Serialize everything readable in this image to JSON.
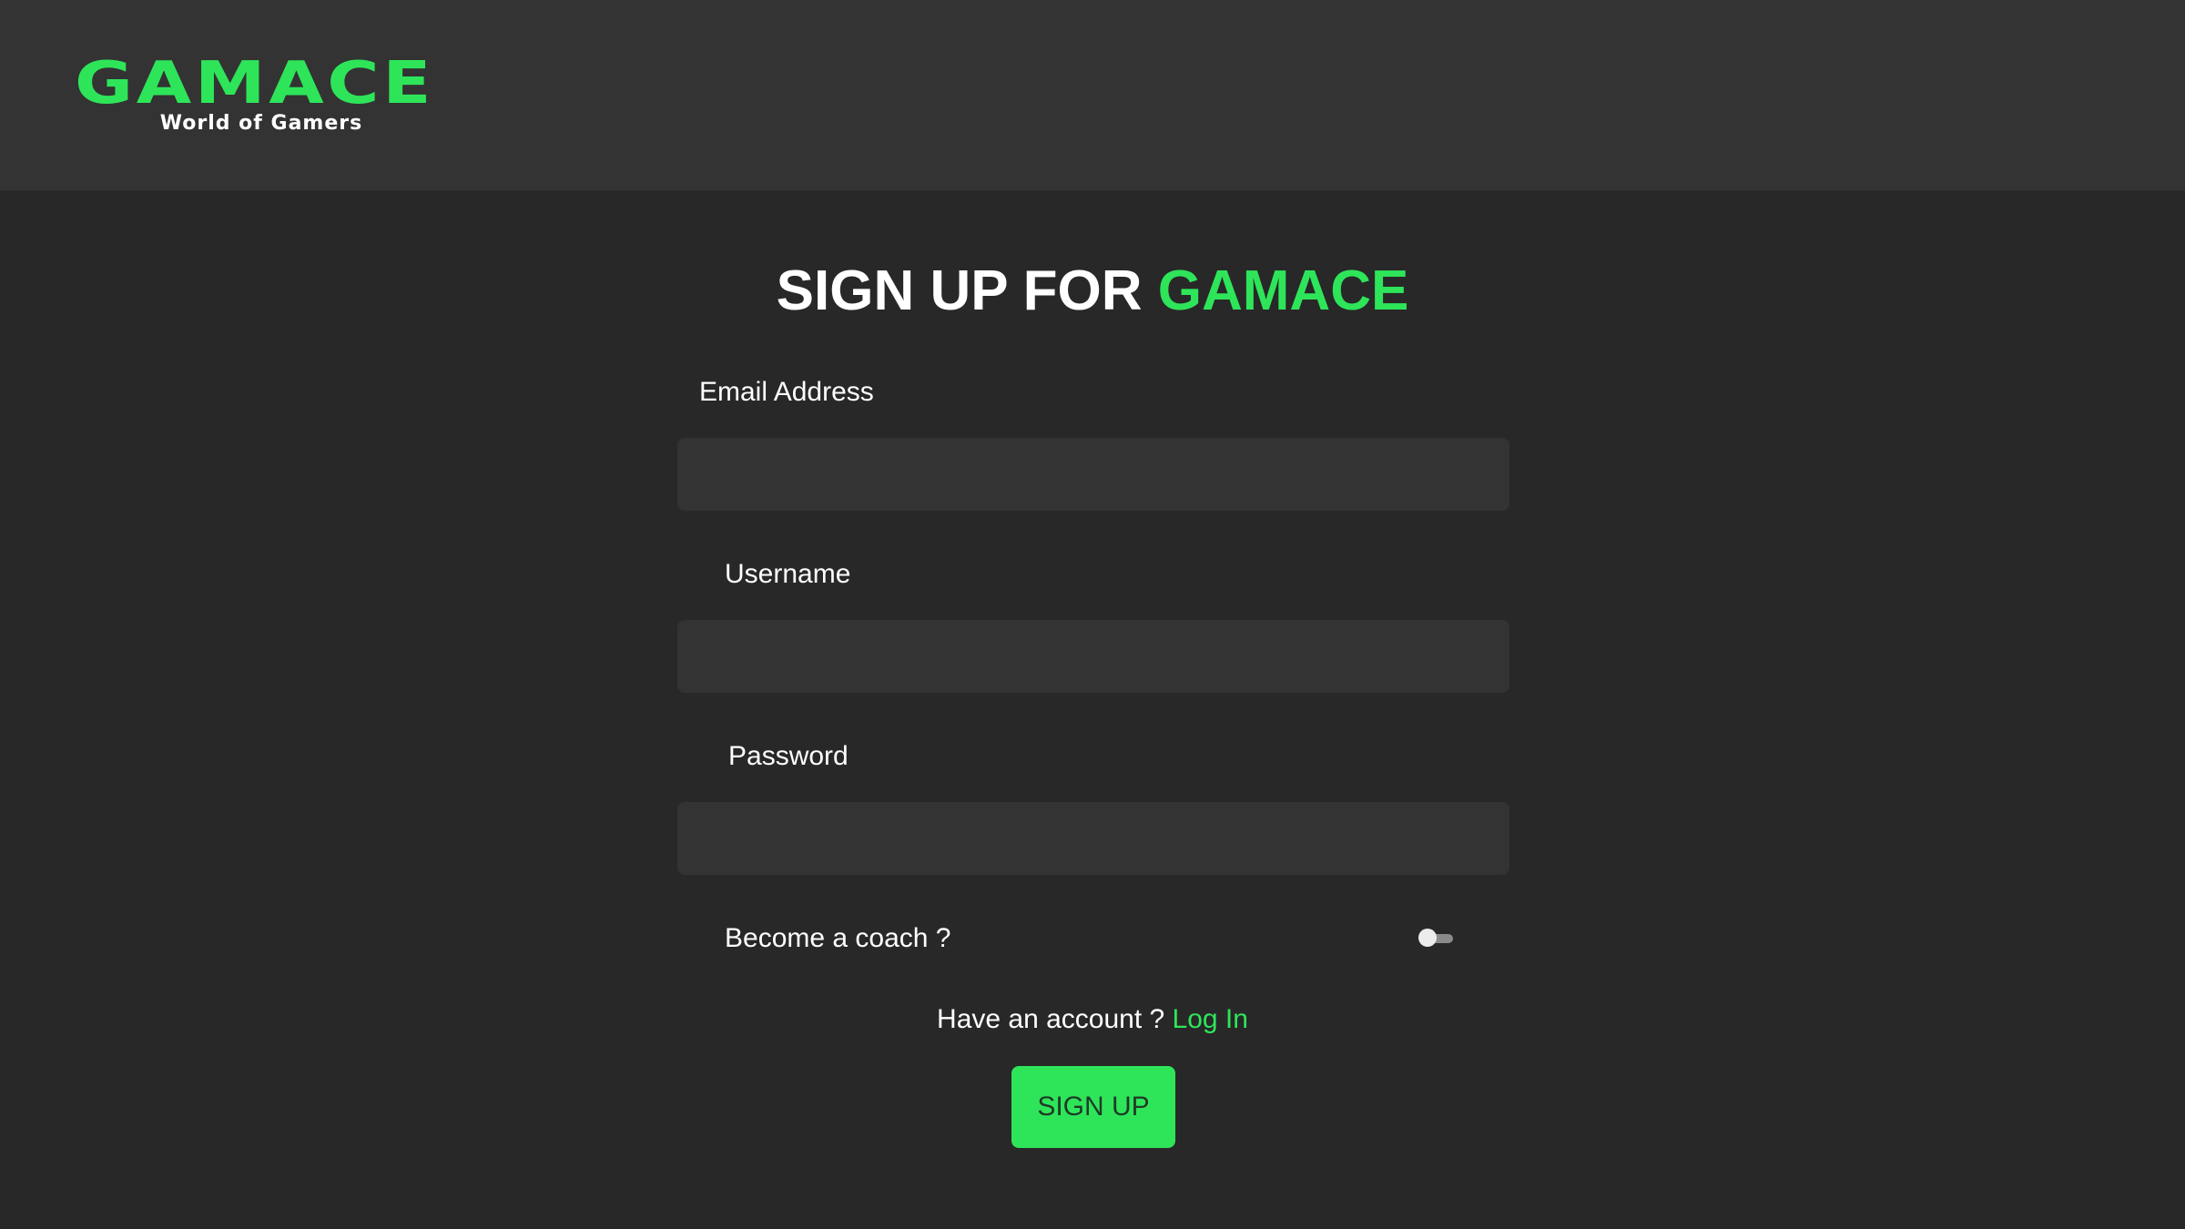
{
  "brand": {
    "logo_name": "GAMACE",
    "logo_tagline": "World of Gamers"
  },
  "title": {
    "prefix": "SIGN UP FOR ",
    "accent": "GAMACE"
  },
  "form": {
    "email_label": "Email Address",
    "email_value": "",
    "username_label": "Username",
    "username_value": "",
    "password_label": "Password",
    "password_value": "",
    "coach_label": "Become a coach ?",
    "coach_toggle_on": false
  },
  "footer": {
    "have_account_text": "Have an account ? ",
    "login_link": "Log In",
    "signup_button": "SIGN UP"
  },
  "colors": {
    "accent": "#2ee55a",
    "header_bg": "#333333",
    "page_bg": "#282828",
    "input_bg": "#333333"
  }
}
